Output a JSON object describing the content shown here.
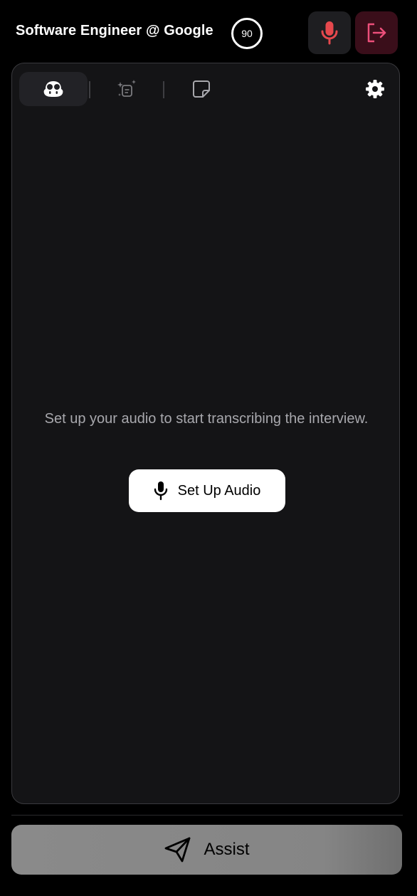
{
  "header": {
    "title": "Software Engineer @ Google",
    "score": "90",
    "mic_icon": "microphone-icon",
    "exit_icon": "exit-icon",
    "mic_color": "#e5484d",
    "exit_color": "#ec4f7a"
  },
  "tabs": [
    {
      "icon": "copilot-icon",
      "active": true
    },
    {
      "icon": "ai-document-icon",
      "active": false
    },
    {
      "icon": "sticky-note-icon",
      "active": false
    }
  ],
  "settings_icon": "gear-icon",
  "transcript": {
    "empty_message": "Set up your audio to start transcribing the interview.",
    "setup_button_label": "Set Up Audio",
    "setup_button_icon": "microphone-icon"
  },
  "assist": {
    "label": "Assist",
    "icon": "paper-plane-icon"
  }
}
